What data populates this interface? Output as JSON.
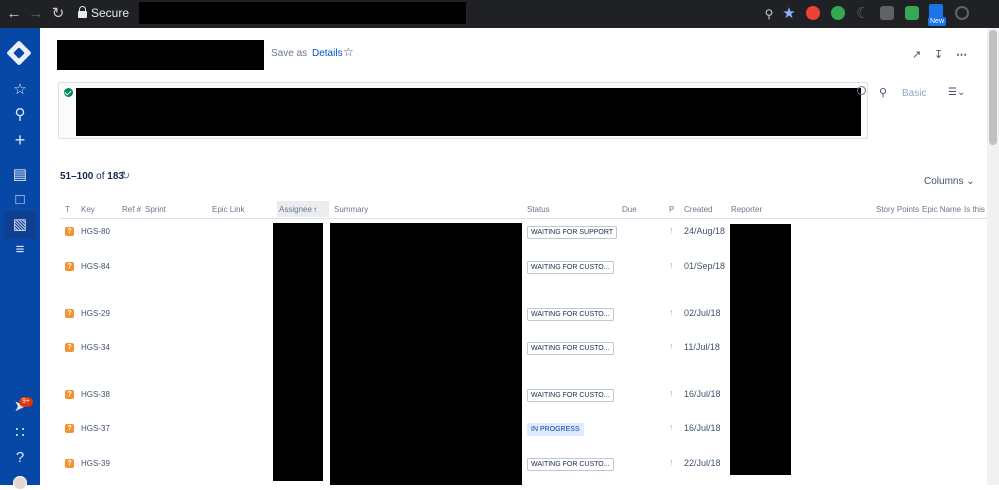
{
  "browser": {
    "secure_label": "Secure",
    "new_badge": "New"
  },
  "header": {
    "save_as": "Save as",
    "details": "Details"
  },
  "search": {
    "mode": "Basic"
  },
  "results": {
    "range": "51–100",
    "of": "of",
    "total": "183",
    "columns_label": "Columns"
  },
  "sidebar": {
    "notification_badge": "9+"
  },
  "table": {
    "headers": {
      "type": "T",
      "key": "Key",
      "ref": "Ref #",
      "sprint": "Sprint",
      "epic_link": "Epic Link",
      "assignee": "Assignee",
      "summary": "Summary",
      "status": "Status",
      "due": "Due",
      "priority": "P",
      "created": "Created",
      "reporter": "Reporter",
      "story_points": "Story Points",
      "epic_name": "Epic Name",
      "is_this": "Is this"
    },
    "rows": [
      {
        "type": "?",
        "key": "HGS-80",
        "status": "WAITING FOR SUPPORT",
        "created": "24/Aug/18"
      },
      {
        "type": "?",
        "key": "HGS-84",
        "status": "WAITING FOR CUSTO...",
        "created": "01/Sep/18"
      },
      {
        "type": "?",
        "key": "HGS-29",
        "status": "WAITING FOR CUSTO...",
        "created": "02/Jul/18"
      },
      {
        "type": "?",
        "key": "HGS-34",
        "status": "WAITING FOR CUSTO...",
        "created": "11/Jul/18"
      },
      {
        "type": "?",
        "key": "HGS-38",
        "status": "WAITING FOR CUSTO...",
        "created": "16/Jul/18"
      },
      {
        "type": "?",
        "key": "HGS-37",
        "status": "IN PROGRESS",
        "created": "16/Jul/18"
      },
      {
        "type": "?",
        "key": "HGS-39",
        "status": "WAITING FOR CUSTO...",
        "created": "22/Jul/18"
      }
    ]
  },
  "colors": {
    "sidebar": "#0747a6",
    "link": "#0052cc",
    "issue_type": "#f79232",
    "in_progress_bg": "#deebff"
  }
}
